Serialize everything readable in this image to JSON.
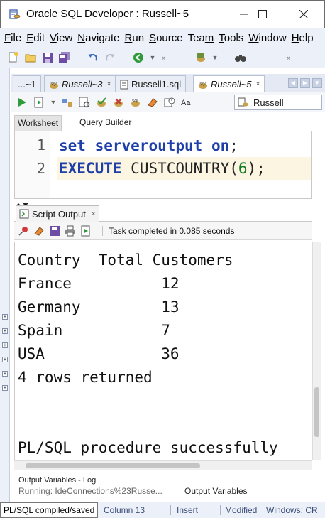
{
  "window": {
    "title": "Oracle SQL Developer : Russell~5"
  },
  "menu": [
    {
      "label": "File",
      "mnemonic": "F",
      "rest": "ile"
    },
    {
      "label": "Edit",
      "mnemonic": "E",
      "rest": "dit"
    },
    {
      "label": "View",
      "mnemonic": "V",
      "rest": "iew"
    },
    {
      "label": "Navigate",
      "mnemonic": "N",
      "rest": "avigate"
    },
    {
      "label": "Run",
      "mnemonic": "R",
      "rest": "un"
    },
    {
      "label": "Source",
      "mnemonic": "S",
      "rest": "ource"
    },
    {
      "label": "Team",
      "mnemonic": "m",
      "pre": "Tea"
    },
    {
      "label": "Tools",
      "mnemonic": "T",
      "rest": "ools"
    },
    {
      "label": "Window",
      "mnemonic": "W",
      "rest": "indow"
    },
    {
      "label": "Help",
      "mnemonic": "H",
      "rest": "elp"
    }
  ],
  "editor_tabs": [
    {
      "label": "...~1",
      "icon": "sql-icon"
    },
    {
      "label": "Russell~3",
      "icon": "sql-icon"
    },
    {
      "label": "Russell1.sql",
      "icon": "document-icon"
    },
    {
      "label": "Russell~5",
      "icon": "sql-icon",
      "active": true
    }
  ],
  "connection": {
    "name": "Russell"
  },
  "worksheet_tabs": [
    "Worksheet",
    "Query Builder"
  ],
  "code": {
    "line1": {
      "num": "1",
      "kw1": "set",
      "kw2": "serveroutput",
      "kw3": "on",
      "rest": ";"
    },
    "line2": {
      "num": "2",
      "kw": "EXECUTE",
      "fn": "CUSTCOUNTRY(",
      "arg": "6",
      "rest": ");"
    }
  },
  "output_panel": {
    "tab_label": "Script Output",
    "status": "Task completed in 0.085 seconds",
    "lines": [
      "Country  Total Customers",
      "France          12",
      "Germany         13",
      "Spain           7",
      "USA             36",
      "4 rows returned",
      "",
      "",
      "PL/SQL procedure successfully"
    ]
  },
  "bottom_panel": {
    "title": "Output Variables - Log",
    "running": "Running: IdeConnections%23Russe...",
    "tab": "Output Variables"
  },
  "statusbar": {
    "tooltip": "PL/SQL compiled/saved",
    "column": "Column 13",
    "mode": "Insert",
    "modified": "Modified",
    "eol": "Windows: CR"
  },
  "colors": {
    "keyword": "#1f3fa8",
    "number": "#117a23",
    "current_line": "#fbf5e2"
  }
}
